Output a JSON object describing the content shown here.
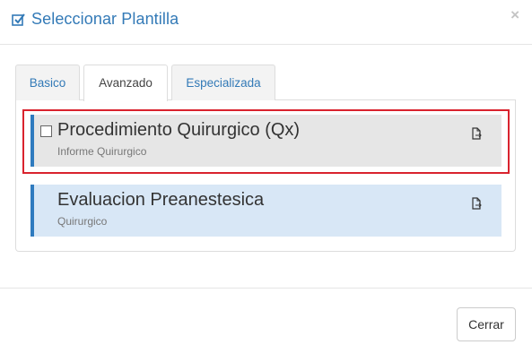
{
  "modal": {
    "title": "Seleccionar Plantilla",
    "close_glyph": "×"
  },
  "tabs": [
    {
      "label": "Basico",
      "active": false
    },
    {
      "label": "Avanzado",
      "active": true
    },
    {
      "label": "Especializada",
      "active": false
    }
  ],
  "templates": [
    {
      "title": "Procedimiento Quirurgico (Qx)",
      "subtitle": "Informe Quirurgico",
      "selected": true,
      "checkbox": "unchecked",
      "icon": "file-export-icon"
    },
    {
      "title": "Evaluacion Preanestesica",
      "subtitle": "Quirurgico",
      "selected": false,
      "icon": "file-export-icon"
    }
  ],
  "footer": {
    "close_label": "Cerrar"
  },
  "colors": {
    "accent": "#337ab7",
    "item_border": "#2f7bbf",
    "highlight": "#d9232e",
    "item1_bg": "#e6e6e6",
    "item2_bg": "#d8e7f6"
  }
}
